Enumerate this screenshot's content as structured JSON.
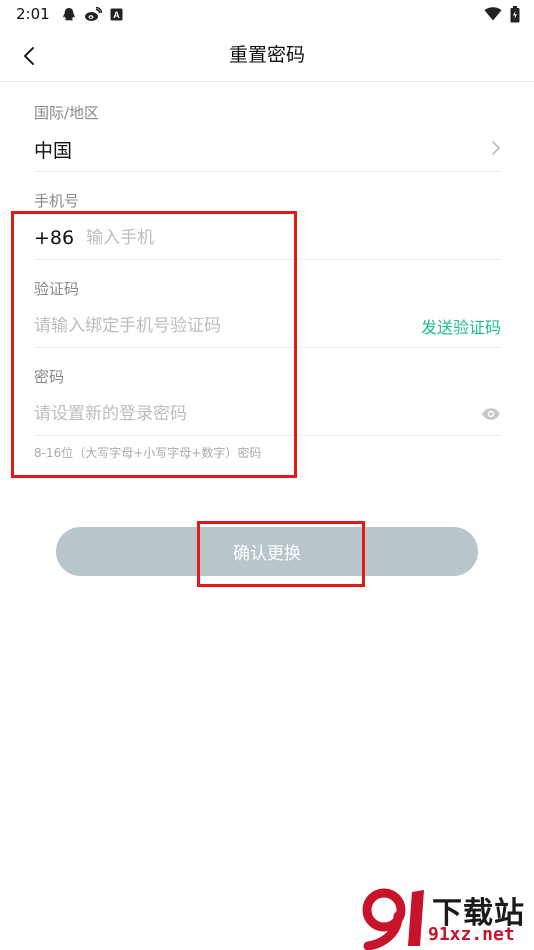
{
  "status_bar": {
    "time": "2:01",
    "left_icons": [
      "qq-icon",
      "weibo-icon",
      "app-a-icon"
    ],
    "right_icons": [
      "wifi-icon",
      "battery-icon"
    ],
    "app_a_glyph": "A"
  },
  "nav": {
    "title": "重置密码"
  },
  "form": {
    "region_label": "国际/地区",
    "region_value": "中国",
    "phone_label": "手机号",
    "country_code": "+86",
    "phone_placeholder": "输入手机",
    "code_label": "验证码",
    "code_placeholder": "请输入绑定手机号验证码",
    "send_code": "发送验证码",
    "password_label": "密码",
    "password_placeholder": "请设置新的登录密码",
    "password_hint": "8-16位（大写字母+小写字母+数字）密码"
  },
  "confirm_button": "确认更换",
  "watermark": {
    "name": "下载站",
    "site": "91xz.net"
  },
  "colors": {
    "accent_green": "#1ec08a",
    "button_disabled": "#b8c6cc",
    "highlight_red": "#e31919"
  }
}
